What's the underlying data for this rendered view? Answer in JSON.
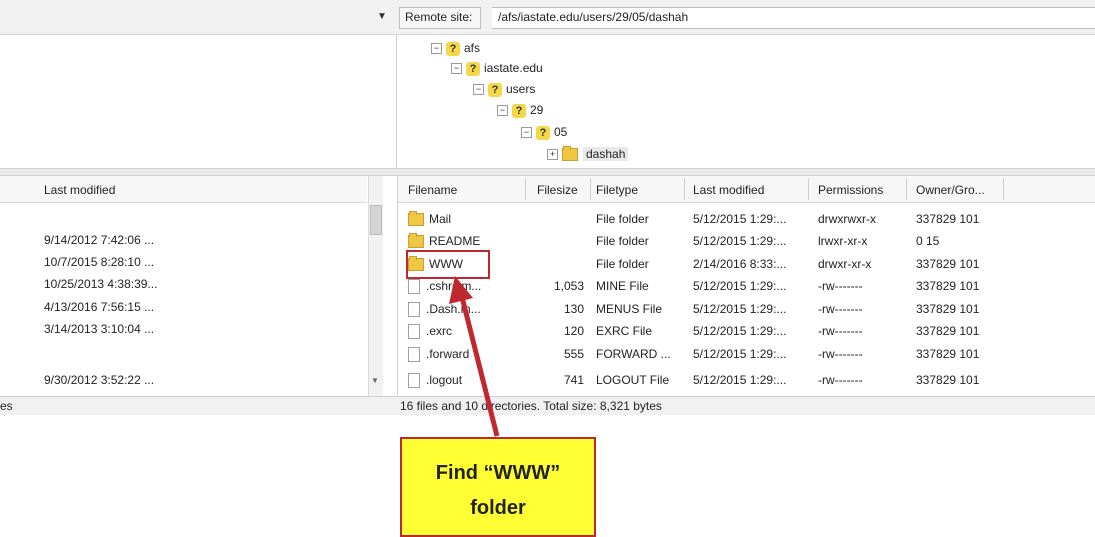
{
  "topbar": {
    "remote_site_label": "Remote site:",
    "remote_path": "/afs/iastate.edu/users/29/05/dashah"
  },
  "remote_tree": {
    "nodes": [
      "afs",
      "iastate.edu",
      "users",
      "29",
      "05",
      "dashah"
    ]
  },
  "local_list": {
    "header_last_modified": "Last modified",
    "dates": [
      "9/14/2012 7:42:06 ...",
      "10/7/2015 8:28:10 ...",
      "10/25/2013 4:38:39...",
      "4/13/2016 7:56:15 ...",
      "3/14/2013 3:10:04 ...",
      "9/30/2012 3:52:22 ..."
    ]
  },
  "remote_list": {
    "columns": [
      "Filename",
      "Filesize",
      "Filetype",
      "Last modified",
      "Permissions",
      "Owner/Gro..."
    ],
    "rows": [
      {
        "name": "Mail",
        "size": "",
        "type": "File folder",
        "modified": "5/12/2015 1:29:...",
        "perms": "drwxrwxr-x",
        "owner": "337829 101"
      },
      {
        "name": "README",
        "size": "",
        "type": "File folder",
        "modified": "5/12/2015 1:29:...",
        "perms": "lrwxr-xr-x",
        "owner": "0 15"
      },
      {
        "name": "WWW",
        "size": "",
        "type": "File folder",
        "modified": "2/14/2016 8:33:...",
        "perms": "drwxr-xr-x",
        "owner": "337829 101"
      },
      {
        "name": ".cshrc.m...",
        "size": "1,053",
        "type": "MINE File",
        "modified": "5/12/2015 1:29:...",
        "perms": "-rw-------",
        "owner": "337829 101"
      },
      {
        "name": ".Dash.m...",
        "size": "130",
        "type": "MENUS File",
        "modified": "5/12/2015 1:29:...",
        "perms": "-rw-------",
        "owner": "337829 101"
      },
      {
        "name": ".exrc",
        "size": "120",
        "type": "EXRC File",
        "modified": "5/12/2015 1:29:...",
        "perms": "-rw-------",
        "owner": "337829 101"
      },
      {
        "name": ".forward",
        "size": "555",
        "type": "FORWARD ...",
        "modified": "5/12/2015 1:29:...",
        "perms": "-rw-------",
        "owner": "337829 101"
      },
      {
        "name": ".logout",
        "size": "741",
        "type": "LOGOUT File",
        "modified": "5/12/2015 1:29:...",
        "perms": "-rw-------",
        "owner": "337829 101"
      }
    ]
  },
  "status": {
    "left": "es",
    "text": "16 files and 10 directories. Total size: 8,321 bytes"
  },
  "annotation": {
    "line1": "Find “WWW”",
    "line2": "folder",
    "accent_color": "#c0282f",
    "callout_color": "#ffff33"
  }
}
